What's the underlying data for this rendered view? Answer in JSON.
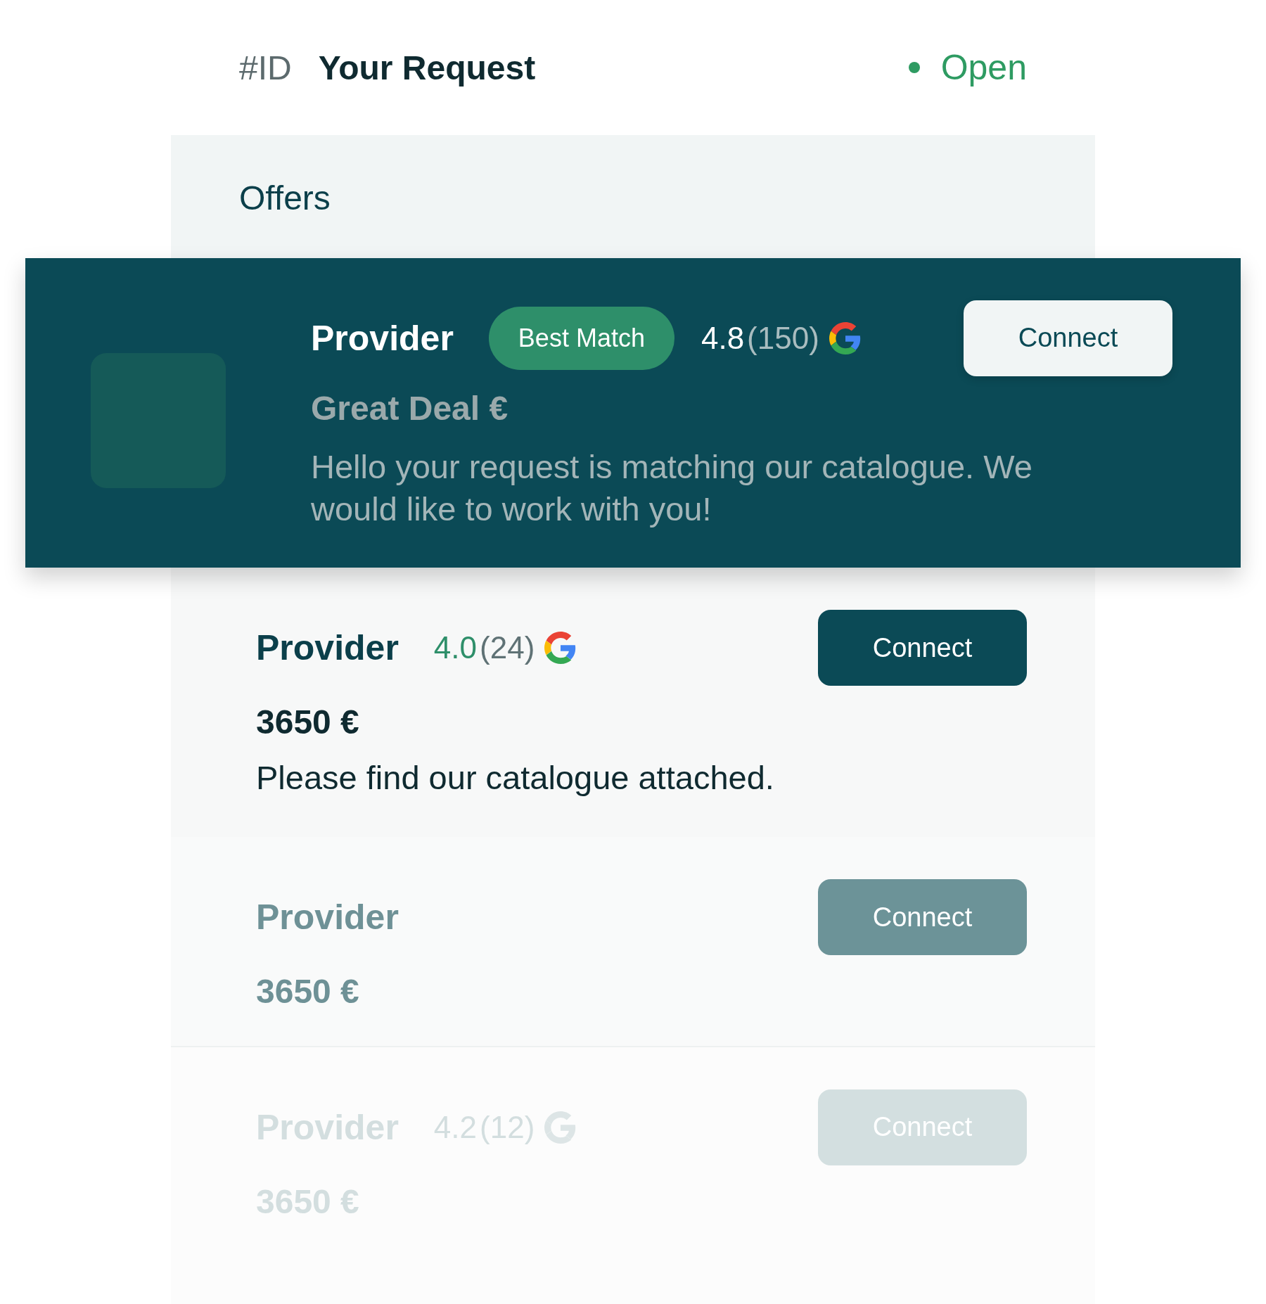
{
  "header": {
    "id_label": "#ID",
    "title": "Your Request",
    "status": {
      "label": "Open",
      "color": "#2e9b62"
    }
  },
  "offers_panel": {
    "title": "Offers",
    "offers": [
      {
        "kind": "featured",
        "provider": "Provider",
        "badge": "Best Match",
        "rating": "4.8",
        "reviews": "(150)",
        "price": "Great Deal €",
        "message": "Hello your request is matching our catalogue. We would like to work with you!",
        "button": "Connect"
      },
      {
        "kind": "normal",
        "provider": "Provider",
        "rating": "4.0",
        "reviews": "(24)",
        "price": "3650 €",
        "message": "Please find our catalogue attached.",
        "button": "Connect"
      },
      {
        "kind": "dimmed",
        "provider": "Provider",
        "price": "3650 €",
        "button": "Connect"
      },
      {
        "kind": "faint",
        "provider": "Provider",
        "rating": "4.2",
        "reviews": "(12)",
        "price": "3650 €",
        "button": "Connect"
      }
    ]
  }
}
